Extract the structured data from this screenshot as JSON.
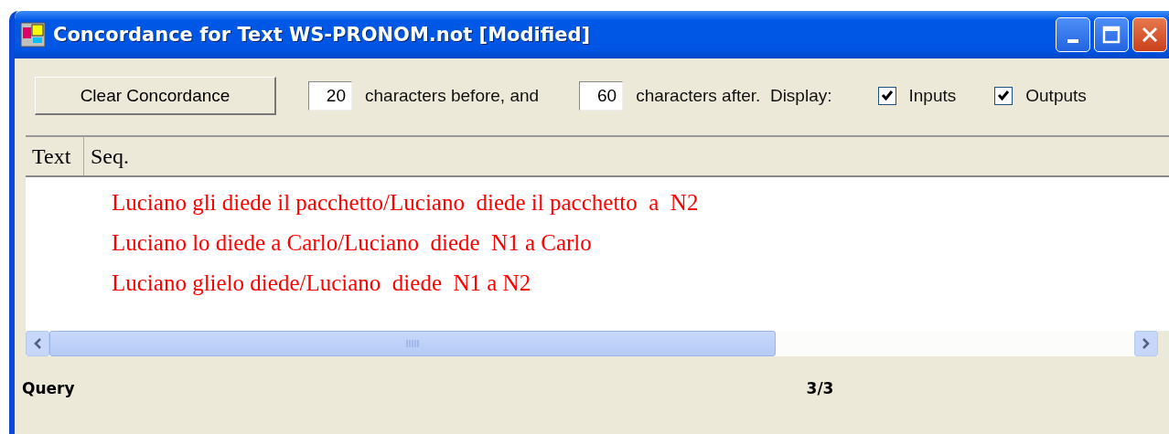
{
  "window": {
    "title": "Concordance for Text WS-PRONOM.not [Modified]"
  },
  "toolbar": {
    "clear_button": "Clear Concordance",
    "before_value": "20",
    "before_label": "characters before, and",
    "after_value": "60",
    "after_label": "characters after.  Display:",
    "checkboxes": [
      {
        "label": "Inputs",
        "checked": true
      },
      {
        "label": "Outputs",
        "checked": true
      }
    ]
  },
  "table": {
    "columns": [
      "Text",
      "Seq."
    ],
    "rows": [
      {
        "seq": "Luciano gli diede il pacchetto/Luciano  diede il pacchetto  a  N2"
      },
      {
        "seq": "Luciano lo diede a Carlo/Luciano  diede  N1 a Carlo"
      },
      {
        "seq": "Luciano glielo diede/Luciano  diede  N1 a N2"
      }
    ]
  },
  "status_bar": {
    "label": "Query",
    "count": "3/3"
  }
}
